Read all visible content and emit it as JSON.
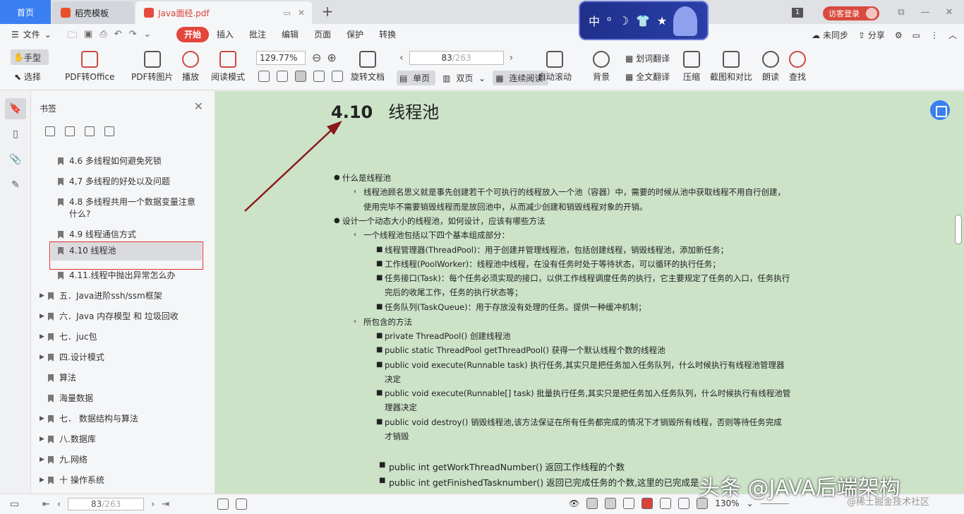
{
  "tabs": {
    "home": "首页",
    "template": "稻壳模板",
    "document": "Java面经.pdf"
  },
  "banner": [
    "中",
    "ᵒ",
    "☽",
    "👕",
    "★"
  ],
  "header": {
    "badge": "1",
    "guest_login": "访客登录"
  },
  "menu": {
    "file": "文件",
    "items": [
      "开始",
      "插入",
      "批注",
      "编辑",
      "页面",
      "保护",
      "转换"
    ],
    "active": "开始",
    "sync": "未同步",
    "share": "分享"
  },
  "ribbon": {
    "hand": "手型",
    "select": "选择",
    "pdf_to_office": "PDF转Office",
    "pdf_to_image": "PDF转图片",
    "play": "播放",
    "read_mode": "阅读模式",
    "zoom": "129.77%",
    "rotate": "旋转文档",
    "page_current": "83",
    "page_total": "/263",
    "single": "单页",
    "double": "双页",
    "continuous": "连续阅读",
    "auto_scroll": "自动滚动",
    "background": "背景",
    "word_translate": "划词翻译",
    "full_translate": "全文翻译",
    "compress": "压缩",
    "screenshot_compare": "截图和对比",
    "read_aloud": "朗读",
    "find": "查找"
  },
  "bookmarks": {
    "title": "书签",
    "items": [
      {
        "label": "4.6 多线程如何避免死锁"
      },
      {
        "label": "4,7 多线程的好处以及问题"
      },
      {
        "label": "4.8 多线程共用一个数据变量注意什么?"
      },
      {
        "label": "4.9 线程通信方式"
      },
      {
        "label": "4.10  线程池"
      },
      {
        "label": "4.11.线程中抛出异常怎么办"
      },
      {
        "label": "五．Java进阶ssh/ssm框架"
      },
      {
        "label": "六．Java 内存模型 和 垃圾回收"
      },
      {
        "label": "七．juc包"
      },
      {
        "label": "四.设计模式"
      },
      {
        "label": "算法"
      },
      {
        "label": "海量数据"
      },
      {
        "label": "七． 数据结构与算法"
      },
      {
        "label": "八.数据库"
      },
      {
        "label": "九.网络"
      },
      {
        "label": "十 操作系统"
      }
    ]
  },
  "document": {
    "heading_number": "4.10",
    "heading_title": "线程池",
    "lines": [
      "什么是线程池",
      "线程池顾名思义就是事先创建若干个可执行的线程放入一个池（容器）中，需要的时候从池中获取线程不用自行创建，",
      "使用完毕不需要销毁线程而是放回池中，从而减少创建和销毁线程对象的开销。",
      "设计一个动态大小的线程池，如何设计，应该有哪些方法",
      "一个线程池包括以下四个基本组成部分：",
      "线程管理器(ThreadPool)：用于创建并管理线程池，包括创建线程，销毁线程池，添加新任务；",
      "工作线程(PoolWorker)：线程池中线程，在没有任务时处于等待状态，可以循环的执行任务；",
      "任务接口(Task)：每个任务必须实现的接口，以供工作线程调度任务的执行，它主要规定了任务的入口，任务执行",
      "完后的收尾工作，任务的执行状态等；",
      "任务队列(TaskQueue)：用于存放没有处理的任务。提供一种缓冲机制；",
      "所包含的方法",
      "private ThreadPool()  创建线程池",
      "public static ThreadPool getThreadPool()  获得一个默认线程个数的线程池",
      " public void execute(Runnable task)  执行任务,其实只是把任务加入任务队列，什么时候执行有线程池管理器",
      "决定",
      "public void execute(Runnable[] task)  批量执行任务,其实只是把任务加入任务队列，什么时候执行有线程池管",
      "理器决定",
      "public void destroy()  销毁线程池,该方法保证在所有任务都完成的情况下才销毁所有线程，否则等待任务完成",
      "才销毁",
      "public int getWorkThreadNumber() 返回工作线程的个数",
      "public int getFinishedTasknumber() 返回已完成任务的个数,这里的已完成是"
    ]
  },
  "watermark": "头条 @JAVA后端架构",
  "watermark_sub": "@稀土掘金技术社区",
  "status": {
    "page_current": "83",
    "page_total": "/263",
    "zoom": "130%"
  }
}
